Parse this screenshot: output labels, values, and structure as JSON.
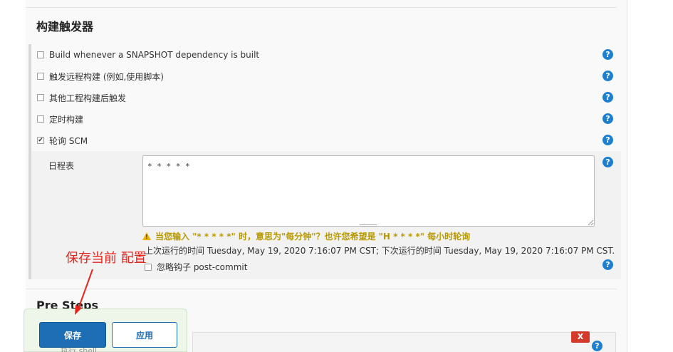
{
  "section_title": "构建触发器",
  "triggers": [
    {
      "label": "Build whenever a SNAPSHOT dependency is built",
      "checked": false
    },
    {
      "label": "触发远程构建 (例如,使用脚本)",
      "checked": false
    },
    {
      "label": "其他工程构建后触发",
      "checked": false
    },
    {
      "label": "定时构建",
      "checked": false
    },
    {
      "label": "轮询 SCM",
      "checked": true
    }
  ],
  "help_glyph": "?",
  "check_glyph": "✔",
  "schedule": {
    "label": "日程表",
    "value": "* * * * *",
    "warning": "当您输入 \"* * * * *\" 时，意思为\"每分钟\"？也许您希望是 \"H * * * *\" 每小时轮询",
    "run_info": "上次运行的时间 Tuesday, May 19, 2020 7:16:07 PM CST; 下次运行的时间 Tuesday, May 19, 2020 7:16:07 PM CST.",
    "ignore_hooks_label": "忽略钩子 post-commit",
    "ignore_hooks_checked": false
  },
  "pre_steps_title": "Pre Steps",
  "annotation_text": "保存当前 配置",
  "buttons": {
    "save": "保存",
    "apply": "应用"
  },
  "delete_label": "X",
  "partial_text": "执行 shell",
  "colors": {
    "help": "#1f7fcf",
    "save_button": "#1d6eb4",
    "warning_text": "#b89a00",
    "annotation": "#e8231c",
    "delete": "#d33a2c"
  }
}
